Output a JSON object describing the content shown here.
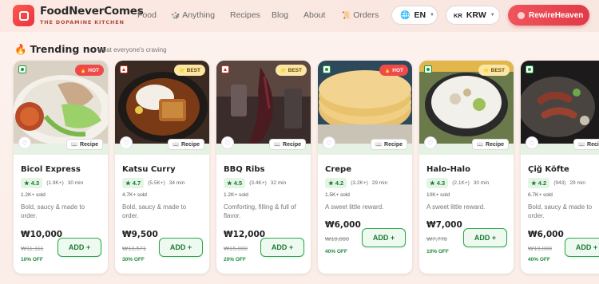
{
  "header": {
    "brand_name": "FoodNeverComes",
    "brand_tagline": "THE DOPAMINE KITCHEN",
    "nav": [
      {
        "label": "Food",
        "icon": ""
      },
      {
        "label": "Anything",
        "icon": "dice-icon"
      },
      {
        "label": "Recipes",
        "icon": ""
      },
      {
        "label": "Blog",
        "icon": ""
      },
      {
        "label": "About",
        "icon": ""
      },
      {
        "label": "Orders",
        "icon": "scroll-icon"
      }
    ],
    "language": "EN",
    "currency_flag": "KR",
    "currency": "KRW",
    "cta_label": "RewireHeaven"
  },
  "section": {
    "title": "Trending now",
    "subtitle": "what everyone's craving"
  },
  "cards": [
    {
      "name": "Bicol Express",
      "badge": "HOT",
      "badge_type": "hot",
      "diet": "veg",
      "rating": "★ 4.3",
      "reviews": "(1.9K+)",
      "time": "30 min",
      "sold": "1.2K+ sold",
      "desc": "Bold, saucy & made to order.",
      "price": "₩10,000",
      "old_price": "₩11,111",
      "off": "10% OFF",
      "recipe": "Recipe"
    },
    {
      "name": "Katsu Curry",
      "badge": "BEST",
      "badge_type": "best",
      "diet": "nonveg",
      "rating": "★ 4.7",
      "reviews": "(5.5K+)",
      "time": "34 min",
      "sold": "4.7K+ sold",
      "desc": "Bold, saucy & made to order.",
      "price": "₩9,500",
      "old_price": "₩13,571",
      "off": "30% OFF",
      "recipe": "Recipe"
    },
    {
      "name": "BBQ Ribs",
      "badge": "BEST",
      "badge_type": "best",
      "diet": "nonveg",
      "rating": "★ 4.5",
      "reviews": "(3.4K+)",
      "time": "32 min",
      "sold": "1.2K+ sold",
      "desc": "Comforting, filling & full of flavor.",
      "price": "₩12,000",
      "old_price": "₩15,000",
      "off": "20% OFF",
      "recipe": "Recipe"
    },
    {
      "name": "Crepe",
      "badge": "HOT",
      "badge_type": "hot",
      "diet": "veg",
      "rating": "★ 4.2",
      "reviews": "(3.2K+)",
      "time": "29 min",
      "sold": "1.5K+ sold",
      "desc": "A sweet little reward.",
      "price": "₩6,000",
      "old_price": "₩10,000",
      "off": "40% OFF",
      "recipe": "Recipe"
    },
    {
      "name": "Halo-Halo",
      "badge": "BEST",
      "badge_type": "best",
      "diet": "veg",
      "rating": "★ 4.3",
      "reviews": "(2.1K+)",
      "time": "30 min",
      "sold": "10K+ sold",
      "desc": "A sweet little reward.",
      "price": "₩7,000",
      "old_price": "₩7,778",
      "off": "10% OFF",
      "recipe": "Recipe"
    },
    {
      "name": "Çiğ Köfte",
      "badge": "",
      "badge_type": "",
      "diet": "veg",
      "rating": "★ 4.2",
      "reviews": "(943)",
      "time": "29 min",
      "sold": "6.7K+ sold",
      "desc": "Bold, saucy & made to order.",
      "price": "₩6,000",
      "old_price": "₩10,000",
      "off": "40% OFF",
      "recipe": "Recipe"
    }
  ],
  "add_label": "ADD +",
  "colors": {
    "accent": "#e8333f",
    "green": "#1d7a35",
    "hot": "#ef4a4a",
    "best": "#fbe6a6"
  }
}
